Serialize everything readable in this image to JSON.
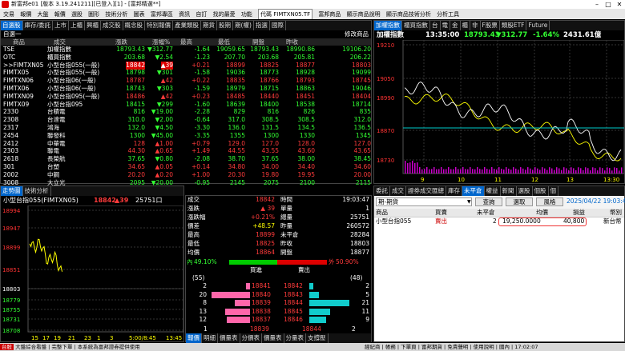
{
  "window": {
    "title": "新富邦e01 [版本 3.19.241211][已登入][1] - [富邦精選**]"
  },
  "menu": {
    "items": [
      "交易",
      "報價",
      "大盤",
      "報價",
      "選股",
      "圖形",
      "技術分析",
      "圖表",
      "富邦專區",
      "資訊",
      "自訂",
      "找的最愛",
      "功能"
    ],
    "right_items": [
      "代碼 FIMTXN05.TF",
      "富邦商品",
      "顯示商品說明",
      "顯示商品技術分析",
      "分析工具"
    ]
  },
  "quote_panel": {
    "tabs": [
      "自選股",
      "庫存/委託",
      "上市",
      "上櫃",
      "興櫃",
      "成交股",
      "概念股",
      "特別報價",
      "產業類股",
      "期貨",
      "股期",
      "期(權)",
      "指選",
      "國際"
    ],
    "group_name": "自選一",
    "modify_link": "修改商品",
    "columns": [
      "商品",
      "成交",
      "漲跌",
      "漲幅%",
      "最高",
      "最低",
      "開盤",
      "昨收"
    ],
    "rows": [
      {
        "code": "TSE",
        "name": "加權指數",
        "price": "18793.43",
        "chg": "▼312.77",
        "pct": "-1.64",
        "high": "19059.65",
        "low": "18793.43",
        "open": "18990.86",
        "prev": "19106.20",
        "cls": "grn"
      },
      {
        "code": "OTC",
        "name": "櫃買指數",
        "price": "203.68",
        "chg": "▼2.54",
        "pct": "-1.23",
        "high": "207.70",
        "low": "203.68",
        "open": "205.81",
        "prev": "206.22",
        "cls": "grn"
      },
      {
        "code": ">>FIMTXN05",
        "name": "小型台指055(一般)",
        "price": "18842",
        "chg": "▲39",
        "pct": "+0.21",
        "high": "18899",
        "low": "18825",
        "open": "18877",
        "prev": "18803",
        "cls": "red",
        "hl": "true"
      },
      {
        "code": "FIMTX05",
        "name": "小型台指055(一般)",
        "price": "18798",
        "chg": "▼301",
        "pct": "-1.58",
        "high": "19036",
        "low": "18773",
        "open": "18928",
        "prev": "19099",
        "cls": "grn"
      },
      {
        "code": "FIMTXN06",
        "name": "小型台指06(一般)",
        "price": "18787",
        "chg": "▲42",
        "pct": "+0.22",
        "high": "18835",
        "low": "18766",
        "open": "18793",
        "prev": "18745",
        "cls": "red"
      },
      {
        "code": "FIMTX06",
        "name": "小型台指06(一般)",
        "price": "18743",
        "chg": "▼303",
        "pct": "-1.59",
        "high": "18979",
        "low": "18715",
        "open": "18863",
        "prev": "19046",
        "cls": "grn"
      },
      {
        "code": "FIMTXN09",
        "name": "小型台指095(一般)",
        "price": "18486",
        "chg": "▲42",
        "pct": "+0.23",
        "high": "18485",
        "low": "18440",
        "open": "18451",
        "prev": "18404",
        "cls": "red"
      },
      {
        "code": "FIMTX09",
        "name": "小型台指095",
        "price": "18415",
        "chg": "▼299",
        "pct": "-1.60",
        "high": "18639",
        "low": "18400",
        "open": "18538",
        "prev": "18714",
        "cls": "grn"
      },
      {
        "code": "2330",
        "name": "台積電",
        "price": "816",
        "chg": "▼19.00",
        "pct": "-2.28",
        "high": "829",
        "low": "816",
        "open": "826",
        "prev": "835",
        "cls": "grn"
      },
      {
        "code": "2308",
        "name": "台達電",
        "price": "310.0",
        "chg": "▼2.00",
        "pct": "-0.64",
        "high": "317.0",
        "low": "308.5",
        "open": "308.5",
        "prev": "312.0",
        "cls": "grn"
      },
      {
        "code": "2317",
        "name": "鴻海",
        "price": "132.0",
        "chg": "▼4.50",
        "pct": "-3.30",
        "high": "136.0",
        "low": "131.5",
        "open": "134.5",
        "prev": "136.5",
        "cls": "grn"
      },
      {
        "code": "2454",
        "name": "聯發科",
        "price": "1300",
        "chg": "▼45.00",
        "pct": "-3.35",
        "high": "1355",
        "low": "1300",
        "open": "1330",
        "prev": "1345",
        "cls": "grn"
      },
      {
        "code": "2412",
        "name": "中華電",
        "price": "128",
        "chg": "▲1.00",
        "pct": "+0.79",
        "high": "129.0",
        "low": "127.0",
        "open": "128.0",
        "prev": "127.0",
        "cls": "red"
      },
      {
        "code": "2303",
        "name": "聯電",
        "price": "44.30",
        "chg": "▲0.65",
        "pct": "+1.49",
        "high": "44.55",
        "low": "43.55",
        "open": "43.60",
        "prev": "43.65",
        "cls": "red"
      },
      {
        "code": "2618",
        "name": "長榮航",
        "price": "37.65",
        "chg": "▼0.80",
        "pct": "-2.08",
        "high": "38.70",
        "low": "37.65",
        "open": "38.00",
        "prev": "38.45",
        "cls": "grn"
      },
      {
        "code": "301",
        "name": "台塑",
        "price": "34.65",
        "chg": "▲0.05",
        "pct": "+0.14",
        "high": "34.80",
        "low": "34.00",
        "open": "34.40",
        "prev": "34.60",
        "cls": "red"
      },
      {
        "code": "2002",
        "name": "中鋼",
        "price": "20.20",
        "chg": "▲0.20",
        "pct": "+1.00",
        "high": "20.30",
        "low": "19.80",
        "open": "19.95",
        "prev": "20.00",
        "cls": "red"
      },
      {
        "code": "3008",
        "name": "大立光",
        "price": "2095",
        "chg": "▼20.00",
        "pct": "-0.95",
        "high": "2145",
        "low": "2075",
        "open": "2100",
        "prev": "2115",
        "cls": "grn"
      }
    ]
  },
  "index_chart": {
    "tabs": [
      "加權指數",
      "櫃買指數",
      "台",
      "電",
      "金",
      "櫃",
      "非",
      "F股票",
      "類股ETF",
      "Future"
    ],
    "name": "加權指數",
    "time": "13:35:00",
    "price": "18793.43",
    "chg": "▼312.77",
    "pct": "-1.64%",
    "volume": "2431.61億",
    "y_ticks": [
      "19210",
      "19050",
      "18990",
      "18870",
      "18730"
    ],
    "x_ticks": [
      "9",
      "10",
      "11",
      "12",
      "13",
      "13:30"
    ]
  },
  "trend_panel": {
    "tabs": [
      "走勢圖",
      "技術分析"
    ],
    "symbol": "小型台指055(FIMTXN05)",
    "price": "18842",
    "chg": "▲39",
    "vol": "25751口",
    "y_ticks": [
      "18994",
      "18947",
      "18899",
      "18851",
      "18803",
      "18779",
      "18755",
      "18731",
      "18708"
    ],
    "x_ticks": [
      "15",
      "17",
      "19",
      "21",
      "23",
      "1",
      "3",
      "5:00/8:45",
      "13:45"
    ]
  },
  "detail": {
    "left": [
      {
        "label": "成交",
        "value": "18842"
      },
      {
        "label": "漲跌",
        "value": "▲ 39"
      },
      {
        "label": "漲跌幅",
        "value": "+0.21%"
      },
      {
        "label": "價差",
        "value": "+48.57"
      },
      {
        "label": "最高",
        "value": "18899"
      },
      {
        "label": "最低",
        "value": "18825"
      },
      {
        "label": "均價",
        "value": "18864"
      }
    ],
    "right": [
      {
        "label": "時間",
        "value": "19:03:47"
      },
      {
        "label": "單量",
        "value": "1"
      },
      {
        "label": "總量",
        "value": "25751"
      },
      {
        "label": "昨量",
        "value": "260572"
      },
      {
        "label": "未平倉",
        "value": "28284"
      },
      {
        "label": "昨收",
        "value": "18803"
      },
      {
        "label": "開盤",
        "value": "18877"
      }
    ],
    "inner_label": "內",
    "inner_pct": "49.10%",
    "outer_label": "外",
    "outer_pct": "50.90%",
    "inner_ratio": 0.491
  },
  "order_book": {
    "buy_title": "買進",
    "sell_title": "賣出",
    "buy_total": "(55)",
    "sell_total": "(48)",
    "rows": [
      {
        "bq": "2",
        "bp": "18841",
        "sp": "18842",
        "sq": "2"
      },
      {
        "bq": "20",
        "bp": "18840",
        "sp": "18843",
        "sq": "5"
      },
      {
        "bq": "8",
        "bp": "18839",
        "sp": "18844",
        "sq": "21"
      },
      {
        "bq": "13",
        "bp": "18838",
        "sp": "18845",
        "sq": "11"
      },
      {
        "bq": "12",
        "bp": "18837",
        "sp": "18846",
        "sq": "9"
      }
    ],
    "sum_bq": "1",
    "sum_bp": "18839",
    "sum_sp": "18844",
    "sum_sq": "2"
  },
  "detail_tabs": [
    "報價",
    "明細",
    "價量表",
    "分價表",
    "價量表",
    "分量表",
    "支撐壓"
  ],
  "trade_panel": {
    "tabs": [
      "委託",
      "成交",
      "證券成交匯總",
      "庫存",
      "未平倉",
      "權益",
      "新聞",
      "選股",
      "個股",
      "個"
    ],
    "account": "期-期貨",
    "btn_query": "查詢",
    "btn_select": "選取",
    "btn_style": "風格",
    "date": "2025/04/22 19:03:45",
    "columns": [
      "商品",
      "買賣",
      "未平倉",
      "均價",
      "損益",
      "幣別"
    ],
    "row": {
      "product": "小型台指055",
      "side": "賣出",
      "qty": "2",
      "avg": "19,250.0000",
      "pnl": "40,800",
      "cur": "新台幣"
    }
  },
  "statusbar": {
    "items": [
      "台股",
      "大盤綜合看盤",
      "完整下單",
      "本系統為富邦證券提供使用"
    ],
    "right_items": [
      "經紀商",
      "帳務",
      "下單頁",
      "富邦期貨",
      "免責聲明",
      "使用說明",
      "國內",
      "17:02:07"
    ]
  }
}
